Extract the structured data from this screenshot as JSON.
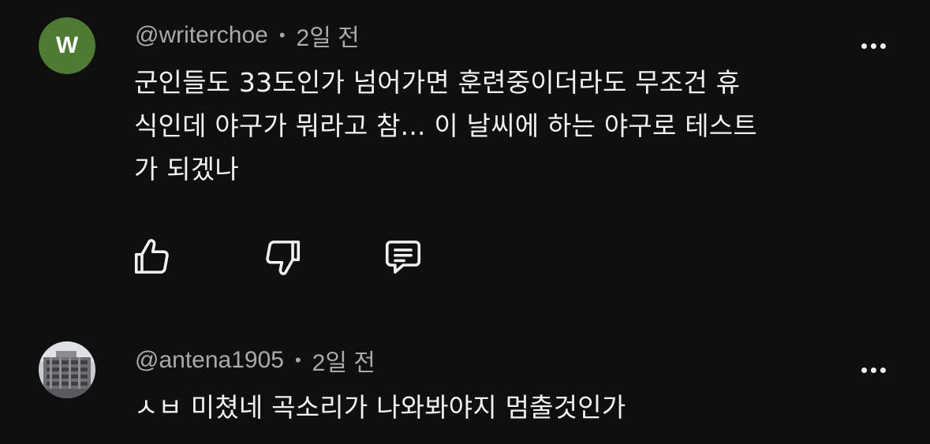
{
  "comments": [
    {
      "avatar_letter": "W",
      "avatar_color": "#4e7a32",
      "handle": "@writerchoe",
      "separator": "•",
      "time": "2일 전",
      "text": "군인들도 33도인가 넘어가면 훈련중이더라도 무조건 휴\n식인데 야구가 뭐라고 참... 이 날씨에 하는 야구로 테스트\n가 되겠나",
      "actions": {
        "like_icon": "thumbs-up-icon",
        "dislike_icon": "thumbs-down-icon",
        "reply_icon": "reply-comment-icon"
      },
      "more_icon": "more-options-icon"
    },
    {
      "avatar_image": "building-photo",
      "handle": "@antena1905",
      "separator": "•",
      "time": "2일 전",
      "text": "ㅅㅂ 미쳤네 곡소리가 나와봐야지 멈출것인가",
      "more_icon": "more-options-icon"
    }
  ],
  "colors": {
    "background": "#0f0f0f",
    "text_primary": "#f1f1f1",
    "text_secondary": "#aaaaaa"
  }
}
